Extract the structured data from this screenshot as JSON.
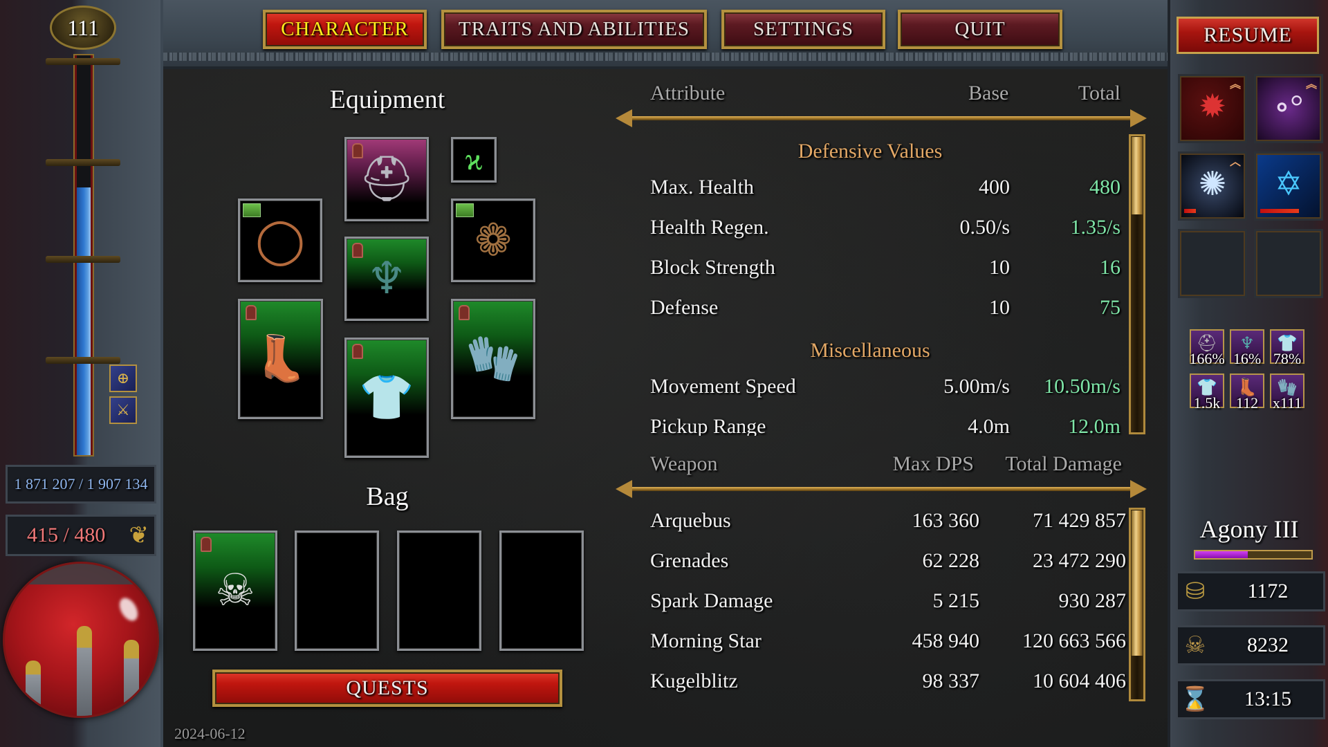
{
  "nav": {
    "tabs": [
      {
        "label": "CHARACTER",
        "active": true
      },
      {
        "label": "TRAITS AND ABILITIES",
        "active": false
      },
      {
        "label": "SETTINGS",
        "active": false
      },
      {
        "label": "QUIT",
        "active": false
      }
    ],
    "resume_label": "RESUME"
  },
  "left_panel": {
    "level": "111",
    "experience_text": "1 871 207 / 1 907 134",
    "experience_bar_fill": 0.67,
    "health_text": "415 / 480",
    "health_fill": 0.865,
    "buff_icons": [
      "shield-buff-icon",
      "sword-buff-icon"
    ],
    "colors": {
      "experience": "#8fb6ee",
      "health": "#f07878"
    }
  },
  "equipment": {
    "title": "Equipment",
    "slots": [
      {
        "slot": "helmet",
        "icon": "helmet-icon",
        "rarity": "pink",
        "locked": true
      },
      {
        "slot": "relic",
        "icon": "bow-rune-icon",
        "rarity": "none",
        "locked": false
      },
      {
        "slot": "left-ring",
        "icon": "bracelet-icon",
        "rarity": "none",
        "locked": false,
        "new": true
      },
      {
        "slot": "amulet",
        "icon": "amulet-icon",
        "rarity": "green",
        "locked": true
      },
      {
        "slot": "right-ring",
        "icon": "flower-ring-icon",
        "rarity": "none",
        "locked": false,
        "new": true
      },
      {
        "slot": "boots",
        "icon": "boots-icon",
        "rarity": "green",
        "locked": true
      },
      {
        "slot": "chest",
        "icon": "tunic-icon",
        "rarity": "green",
        "locked": true
      },
      {
        "slot": "gloves",
        "icon": "gloves-icon",
        "rarity": "green",
        "locked": true
      }
    ]
  },
  "bag": {
    "title": "Bag",
    "slots": [
      {
        "icon": "skull-mask-icon",
        "filled": true,
        "locked": true
      },
      {
        "filled": false
      },
      {
        "filled": false
      },
      {
        "filled": false
      }
    ],
    "quests_label": "QUESTS"
  },
  "date": "2024-06-12",
  "attributes": {
    "headers": {
      "attribute": "Attribute",
      "base": "Base",
      "total": "Total"
    },
    "groups": [
      {
        "title": "Defensive Values",
        "rows": [
          {
            "name": "Max. Health",
            "base": "400",
            "total": "480"
          },
          {
            "name": "Health Regen.",
            "base": "0.50/s",
            "total": "1.35/s"
          },
          {
            "name": "Block Strength",
            "base": "10",
            "total": "16"
          },
          {
            "name": "Defense",
            "base": "10",
            "total": "75"
          }
        ]
      },
      {
        "title": "Miscellaneous",
        "rows": [
          {
            "name": "Movement Speed",
            "base": "5.00m/s",
            "total": "10.50m/s"
          },
          {
            "name": "Pickup Range",
            "base": "4.0m",
            "total": "12.0m"
          }
        ]
      }
    ],
    "scroll_position": 0.0,
    "colors": {
      "group_title": "#e3a866",
      "total": "#7fe6a8"
    }
  },
  "weapons": {
    "headers": {
      "weapon": "Weapon",
      "max_dps": "Max DPS",
      "total_damage": "Total Damage"
    },
    "rows": [
      {
        "name": "Arquebus",
        "max_dps": "163 360",
        "total_damage": "71 429 857"
      },
      {
        "name": "Grenades",
        "max_dps": "62 228",
        "total_damage": "23 472 290"
      },
      {
        "name": "Spark Damage",
        "max_dps": "5 215",
        "total_damage": "930 287"
      },
      {
        "name": "Morning Star",
        "max_dps": "458 940",
        "total_damage": "120 663 566"
      },
      {
        "name": "Kugelblitz",
        "max_dps": "98 337",
        "total_damage": "10 604 406"
      }
    ],
    "scroll_position": 0.0
  },
  "right_panel": {
    "skills": [
      {
        "name": "morning-star",
        "icon": "morning-star-icon",
        "rank_chevrons": 2,
        "cooldown": null
      },
      {
        "name": "cosmic-orbs",
        "icon": "cosmic-orbs-icon",
        "rank_chevrons": 2,
        "cooldown": null
      },
      {
        "name": "spark-burst",
        "icon": "spark-burst-icon",
        "rank_chevrons": 1,
        "cooldown": 0.2
      },
      {
        "name": "kugelblitz-stars",
        "icon": "blue-stars-icon",
        "rank_chevrons": 0,
        "cooldown": 0.65
      },
      {
        "name": "empty-1",
        "icon": null
      },
      {
        "name": "empty-2",
        "icon": null
      }
    ],
    "set_bonuses": [
      {
        "icon": "helmet-icon",
        "label": "166%"
      },
      {
        "icon": "amulet-icon",
        "label": "16%"
      },
      {
        "icon": "tunic-icon",
        "label": "78%"
      },
      {
        "icon": "tunic-icon",
        "label": "1.5k"
      },
      {
        "icon": "boots-icon",
        "label": "112"
      },
      {
        "icon": "gloves-icon",
        "label": "x111"
      }
    ],
    "difficulty": {
      "label": "Agony III",
      "progress": 0.45,
      "color": "#b020d8"
    },
    "resources": [
      {
        "icon": "gold-coins-icon",
        "value": "1172"
      },
      {
        "icon": "skull-icon",
        "value": "8232"
      },
      {
        "icon": "hourglass-icon",
        "value": "13:15"
      }
    ]
  }
}
